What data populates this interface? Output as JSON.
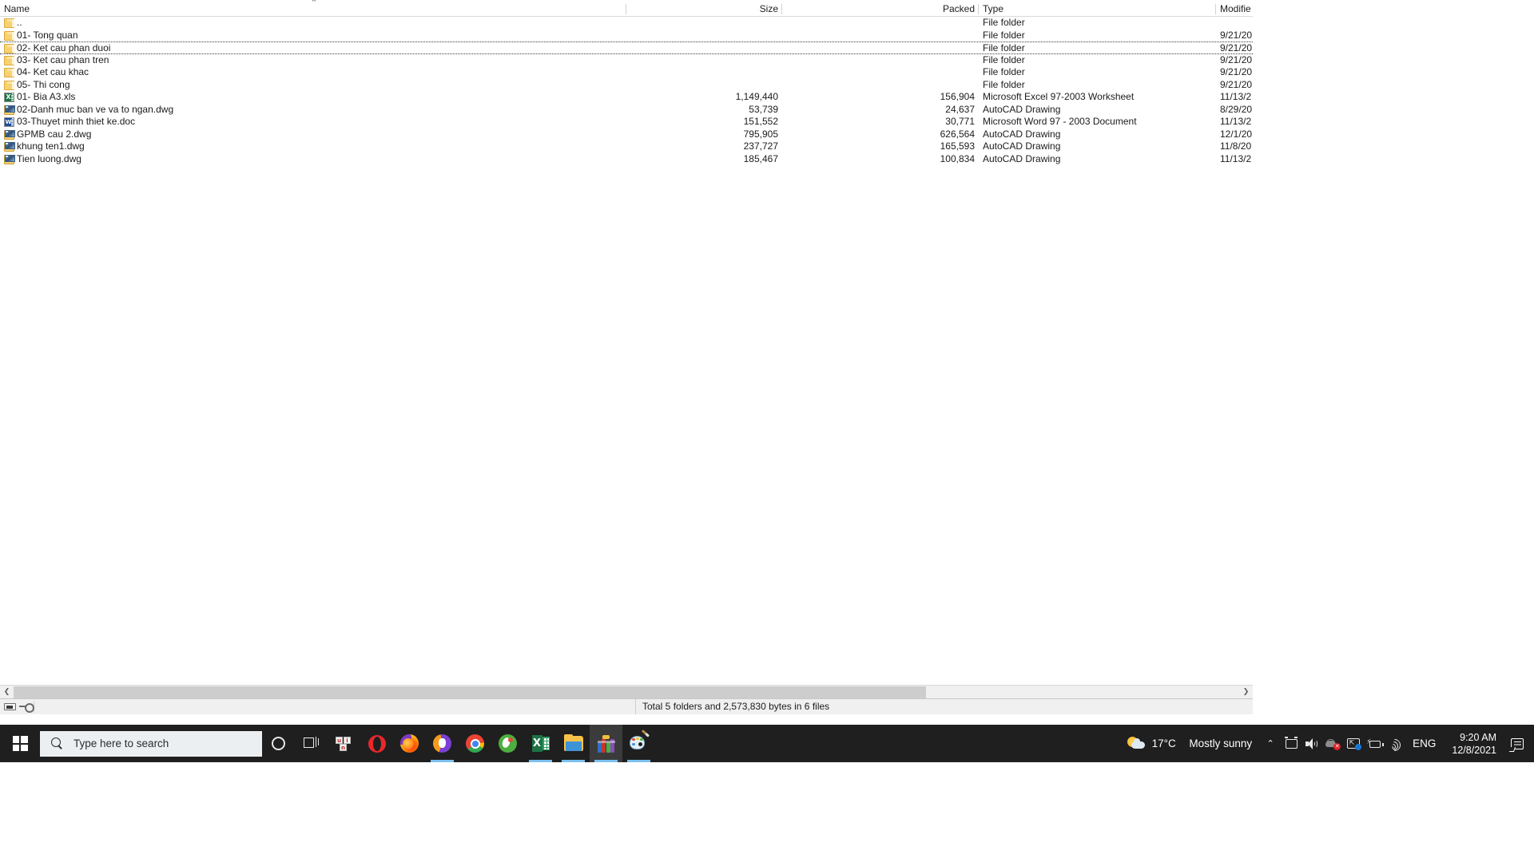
{
  "window": {
    "title": "WinRAR file list",
    "sort_indicator": "⌃"
  },
  "columns": {
    "name": "Name",
    "size": "Size",
    "packed": "Packed",
    "type": "Type",
    "modified": "Modifie"
  },
  "rows": [
    {
      "name": "..",
      "icon": "folder",
      "size": "",
      "packed": "",
      "type": "File folder",
      "modified": ""
    },
    {
      "name": "01- Tong quan",
      "icon": "folder",
      "size": "",
      "packed": "",
      "type": "File folder",
      "modified": "9/21/20"
    },
    {
      "name": "02- Ket cau phan duoi",
      "icon": "folder",
      "size": "",
      "packed": "",
      "type": "File folder",
      "modified": "9/21/20"
    },
    {
      "name": "03- Ket cau phan tren",
      "icon": "folder",
      "size": "",
      "packed": "",
      "type": "File folder",
      "modified": "9/21/20"
    },
    {
      "name": "04- Ket cau khac",
      "icon": "folder",
      "size": "",
      "packed": "",
      "type": "File folder",
      "modified": "9/21/20"
    },
    {
      "name": "05- Thi cong",
      "icon": "folder",
      "size": "",
      "packed": "",
      "type": "File folder",
      "modified": "9/21/20"
    },
    {
      "name": "01- Bia A3.xls",
      "icon": "xls",
      "size": "1,149,440",
      "packed": "156,904",
      "type": "Microsoft Excel 97-2003 Worksheet",
      "modified": "11/13/2"
    },
    {
      "name": "02-Danh muc ban ve va to ngan.dwg",
      "icon": "dwg",
      "size": "53,739",
      "packed": "24,637",
      "type": "AutoCAD Drawing",
      "modified": "8/29/20"
    },
    {
      "name": "03-Thuyet minh thiet ke.doc",
      "icon": "doc",
      "size": "151,552",
      "packed": "30,771",
      "type": "Microsoft Word 97 - 2003 Document",
      "modified": "11/13/2"
    },
    {
      "name": "GPMB cau 2.dwg",
      "icon": "dwg",
      "size": "795,905",
      "packed": "626,564",
      "type": "AutoCAD Drawing",
      "modified": "12/1/20"
    },
    {
      "name": "khung ten1.dwg",
      "icon": "dwg",
      "size": "237,727",
      "packed": "165,593",
      "type": "AutoCAD Drawing",
      "modified": "11/8/20"
    },
    {
      "name": "Tien luong.dwg",
      "icon": "dwg",
      "size": "185,467",
      "packed": "100,834",
      "type": "AutoCAD Drawing",
      "modified": "11/13/2"
    }
  ],
  "focused_row_index": 2,
  "scrollbar": {
    "left_arrow": "❮",
    "right_arrow": "❯"
  },
  "statusbar": {
    "total": "Total 5 folders and 2,573,830 bytes in 6 files"
  },
  "taskbar": {
    "start_label": "Start",
    "search_placeholder": "Type here to search",
    "items": [
      {
        "name": "cortana",
        "label": "Cortana",
        "active": false,
        "running": false
      },
      {
        "name": "task-view",
        "label": "Task View",
        "active": false,
        "running": false
      },
      {
        "name": "unikey",
        "label": "UniKey",
        "active": false,
        "running": false
      },
      {
        "name": "opera",
        "label": "Opera",
        "active": false,
        "running": false
      },
      {
        "name": "firefox",
        "label": "Mozilla Firefox",
        "active": false,
        "running": false
      },
      {
        "name": "avast",
        "label": "Avast Secure Browser",
        "active": false,
        "running": true
      },
      {
        "name": "chrome",
        "label": "Google Chrome",
        "active": false,
        "running": false
      },
      {
        "name": "coccoc",
        "label": "Coc Coc",
        "active": false,
        "running": false
      },
      {
        "name": "excel",
        "label": "Microsoft Excel",
        "active": false,
        "running": true
      },
      {
        "name": "file-explorer",
        "label": "File Explorer",
        "active": false,
        "running": true
      },
      {
        "name": "winrar",
        "label": "WinRAR",
        "active": true,
        "running": true
      },
      {
        "name": "paint",
        "label": "Paint",
        "active": false,
        "running": true
      }
    ],
    "tray": {
      "weather_temp": "17°C",
      "weather_desc": "Mostly sunny",
      "chevron": "⌃",
      "language": "ENG",
      "time": "9:20 AM",
      "date": "12/8/2021",
      "icons": [
        {
          "name": "meet-now",
          "label": "Meet Now"
        },
        {
          "name": "volume",
          "label": "Speakers"
        },
        {
          "name": "microphone-muted",
          "label": "Microphone muted"
        },
        {
          "name": "onedrive",
          "label": "OneDrive"
        },
        {
          "name": "battery",
          "label": "Battery charging"
        },
        {
          "name": "wifi",
          "label": "Network"
        }
      ]
    }
  },
  "colors": {
    "taskbar_bg": "#1f1f1f",
    "accent": "#7cc0f0",
    "panel_bg": "#f6f6f6",
    "window_bg": "#ffffff"
  }
}
